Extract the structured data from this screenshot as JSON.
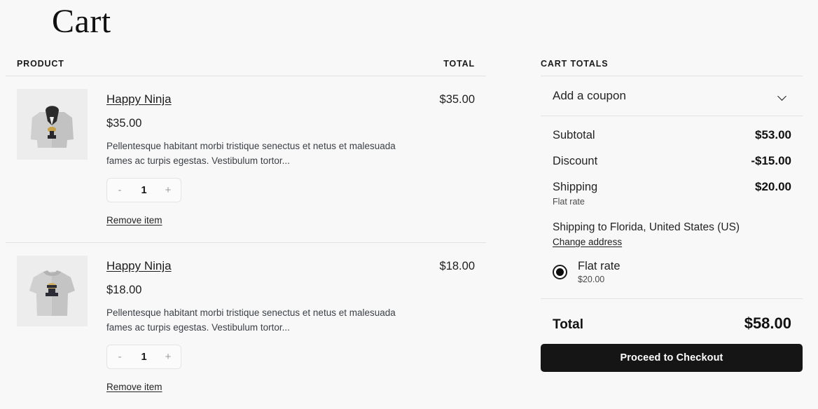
{
  "page": {
    "title": "Cart"
  },
  "table": {
    "product_header": "PRODUCT",
    "total_header": "TOTAL"
  },
  "items": [
    {
      "thumb": "hoodie-image",
      "name": "Happy Ninja",
      "price": "$35.00",
      "description": "Pellentesque habitant morbi tristique senectus et netus et malesuada fames ac turpis egestas. Vestibulum tortor...",
      "decrement_label": "-",
      "quantity": "1",
      "increment_label": "+",
      "remove_label": "Remove item",
      "line_total": "$35.00"
    },
    {
      "thumb": "tshirt-image",
      "name": "Happy Ninja",
      "price": "$18.00",
      "description": "Pellentesque habitant morbi tristique senectus et netus et malesuada fames ac turpis egestas. Vestibulum tortor...",
      "decrement_label": "-",
      "quantity": "1",
      "increment_label": "+",
      "remove_label": "Remove item",
      "line_total": "$18.00"
    }
  ],
  "totals": {
    "heading": "CART TOTALS",
    "coupon_label": "Add a coupon",
    "subtotal_label": "Subtotal",
    "subtotal_value": "$53.00",
    "discount_label": "Discount",
    "discount_value": "-$15.00",
    "shipping_label": "Shipping",
    "shipping_value": "$20.00",
    "shipping_note": "Flat rate",
    "shipping_destination": "Shipping to Florida, United States (US)",
    "change_address_label": "Change address",
    "shipping_option_name": "Flat rate",
    "shipping_option_price": "$20.00",
    "total_label": "Total",
    "total_value": "$58.00",
    "checkout_label": "Proceed to Checkout"
  },
  "colors": {
    "page_background": "#f8f8f8",
    "divider": "#e2e2e2",
    "checkout_button": "#151515",
    "text_primary": "#1f1f1f"
  }
}
